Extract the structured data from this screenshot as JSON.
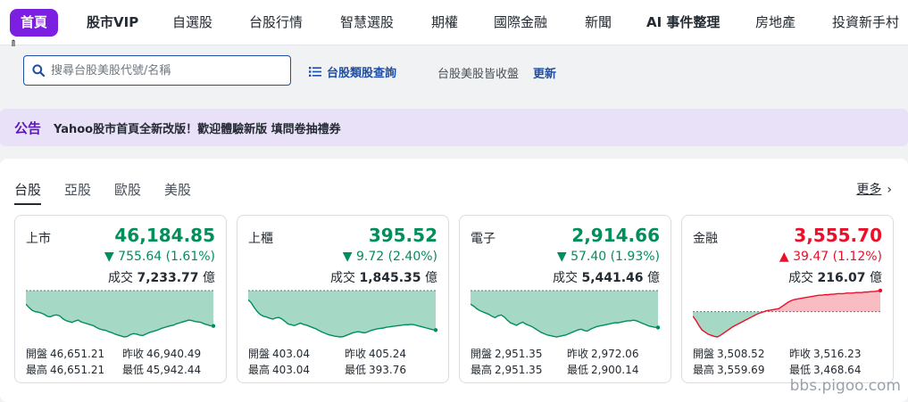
{
  "nav": {
    "items": [
      {
        "label": "首頁",
        "active": true
      },
      {
        "label": "股市VIP",
        "bold": true
      },
      {
        "label": "自選股"
      },
      {
        "label": "台股行情"
      },
      {
        "label": "智慧選股"
      },
      {
        "label": "期權"
      },
      {
        "label": "國際金融"
      },
      {
        "label": "新聞"
      },
      {
        "label": "AI 事件整理",
        "bold": true
      },
      {
        "label": "房地產"
      },
      {
        "label": "投資新手村"
      }
    ]
  },
  "search": {
    "placeholder": "搜尋台股美股代號/名稱",
    "category_link": "台股類股查詢",
    "sub_text": "台股美股皆收盤",
    "update_link": "更新"
  },
  "announcement": {
    "tag": "公告",
    "message": "Yahoo股市首頁全新改版！歡迎體驗新版 填問卷抽禮券"
  },
  "market": {
    "tabs": [
      "台股",
      "亞股",
      "歐股",
      "美股"
    ],
    "active_tab": "台股",
    "more_label": "更多",
    "volume_label": "成交",
    "volume_unit": "億",
    "open_label": "開盤",
    "high_label": "最高",
    "prev_label": "昨收",
    "low_label": "最低",
    "cards": [
      {
        "name": "上市",
        "price": "46,184.85",
        "direction": "down",
        "arrow": "▼",
        "change": "755.64 (1.61%)",
        "volume": "7,233.77",
        "open": "46,651.21",
        "high": "46,651.21",
        "prev": "46,940.49",
        "low": "45,942.44",
        "spark": [
          46651,
          46580,
          46520,
          46490,
          46480,
          46460,
          46430,
          46390,
          46380,
          46410,
          46420,
          46400,
          46340,
          46300,
          46280,
          46260,
          46290,
          46310,
          46270,
          46250,
          46230,
          46210,
          46190,
          46150,
          46120,
          46100,
          46090,
          46060,
          46040,
          46010,
          45990,
          45970,
          45950,
          45960,
          46000,
          46020,
          46010,
          45990,
          45980,
          46010,
          46040,
          46060,
          46080,
          46100,
          46130,
          46150,
          46170,
          46190,
          46200,
          46230,
          46250,
          46270,
          46290,
          46310,
          46300,
          46280,
          46270,
          46260,
          46230,
          46210,
          46190,
          46185
        ],
        "spark_base": 46940.49
      },
      {
        "name": "上櫃",
        "price": "395.52",
        "direction": "down",
        "arrow": "▼",
        "change": "9.72 (2.40%)",
        "volume": "1,845.35",
        "open": "403.04",
        "high": "403.04",
        "prev": "405.24",
        "low": "393.76",
        "spark": [
          403.0,
          402.2,
          401.0,
          400.0,
          399.3,
          398.9,
          398.7,
          398.4,
          398.2,
          398.5,
          398.6,
          398.2,
          397.6,
          397.0,
          396.8,
          396.6,
          396.9,
          397.2,
          396.9,
          396.7,
          396.4,
          396.1,
          395.8,
          395.4,
          395.0,
          394.7,
          394.4,
          394.2,
          394.0,
          393.9,
          393.8,
          393.9,
          394.2,
          394.5,
          394.8,
          395.0,
          395.1,
          394.9,
          394.8,
          395.1,
          395.4,
          395.6,
          395.8,
          395.9,
          396.0,
          396.2,
          396.3,
          396.4,
          396.5,
          396.6,
          396.7,
          396.8,
          396.8,
          396.9,
          396.8,
          396.6,
          396.4,
          396.2,
          396.0,
          395.8,
          395.6,
          395.5
        ],
        "spark_base": 405.24
      },
      {
        "name": "電子",
        "price": "2,914.66",
        "direction": "down",
        "arrow": "▼",
        "change": "57.40 (1.93%)",
        "volume": "5,441.46",
        "open": "2,951.35",
        "high": "2,951.35",
        "prev": "2,972.06",
        "low": "2,900.14",
        "spark": [
          2951,
          2948,
          2944,
          2941,
          2939,
          2937,
          2935,
          2932,
          2930,
          2933,
          2934,
          2931,
          2926,
          2922,
          2920,
          2918,
          2921,
          2923,
          2920,
          2918,
          2916,
          2913,
          2910,
          2907,
          2905,
          2903,
          2902,
          2901,
          2900,
          2901,
          2902,
          2903,
          2905,
          2907,
          2909,
          2911,
          2912,
          2910,
          2909,
          2912,
          2914,
          2916,
          2917,
          2918,
          2919,
          2920,
          2921,
          2922,
          2922,
          2923,
          2924,
          2925,
          2925,
          2926,
          2925,
          2923,
          2921,
          2919,
          2917,
          2916,
          2915,
          2914.66
        ],
        "spark_base": 2972.06
      },
      {
        "name": "金融",
        "price": "3,555.70",
        "direction": "up",
        "arrow": "▲",
        "change": "39.47 (1.12%)",
        "volume": "216.07",
        "open": "3,508.52",
        "high": "3,559.69",
        "prev": "3,516.23",
        "low": "3,468.64",
        "spark": [
          3508,
          3500,
          3490,
          3482,
          3478,
          3474,
          3472,
          3470,
          3469,
          3472,
          3476,
          3480,
          3484,
          3488,
          3491,
          3494,
          3497,
          3500,
          3503,
          3506,
          3509,
          3512,
          3514,
          3516,
          3518,
          3519,
          3520,
          3521,
          3522,
          3526,
          3530,
          3534,
          3537,
          3539,
          3540,
          3541,
          3542,
          3543,
          3544,
          3545,
          3546,
          3547,
          3547,
          3548,
          3548,
          3549,
          3549,
          3550,
          3550,
          3550,
          3551,
          3551,
          3551,
          3552,
          3552,
          3552,
          3553,
          3553,
          3554,
          3554,
          3555,
          3555.7
        ],
        "spark_base": 3516.23
      }
    ]
  },
  "watermark": "bbs.pigoo.com",
  "colors": {
    "accent": "#7b1fe0",
    "up": "#eb0f29",
    "down": "#008f5b",
    "link": "#1e4ea8"
  }
}
